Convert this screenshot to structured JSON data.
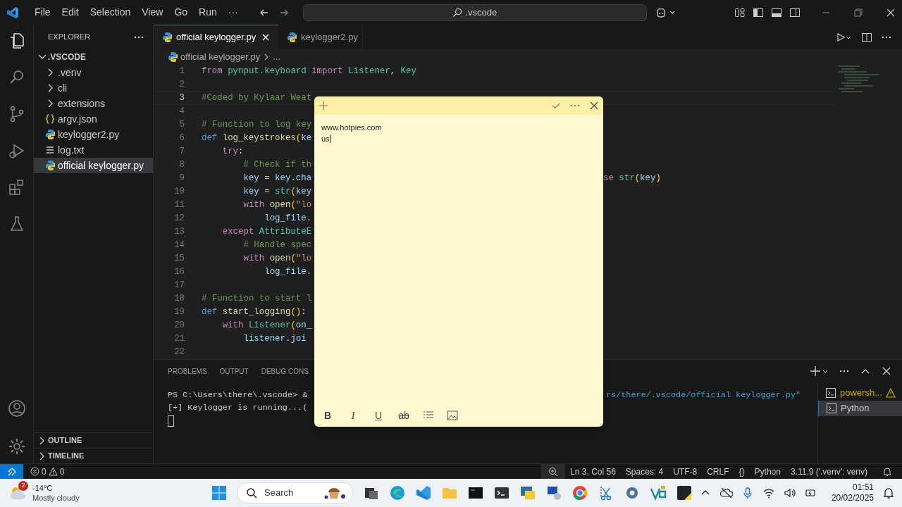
{
  "menu": [
    "File",
    "Edit",
    "Selection",
    "View",
    "Go",
    "Run",
    "···"
  ],
  "command_center": {
    "value": ".vscode"
  },
  "sidebar": {
    "title": "EXPLORER",
    "folder": ".VSCODE",
    "items": [
      {
        "label": ".venv",
        "kind": "folder",
        "selected": false
      },
      {
        "label": "cli",
        "kind": "folder",
        "selected": false
      },
      {
        "label": "extensions",
        "kind": "folder",
        "selected": false
      },
      {
        "label": "argv.json",
        "kind": "json",
        "selected": false
      },
      {
        "label": "keylogger2.py",
        "kind": "python",
        "selected": false
      },
      {
        "label": "log.txt",
        "kind": "text",
        "selected": false
      },
      {
        "label": "official keylogger.py",
        "kind": "python",
        "selected": true
      }
    ],
    "sections": [
      "OUTLINE",
      "TIMELINE"
    ]
  },
  "tabs": [
    {
      "label": "official keylogger.py",
      "selected": true
    },
    {
      "label": "keylogger2.py",
      "selected": false
    }
  ],
  "breadcrumb": [
    "official keylogger.py",
    "..."
  ],
  "code": [
    {
      "n": "1",
      "active": false,
      "tokens": [
        {
          "kind": "keyword",
          "text": "from "
        },
        {
          "kind": "module",
          "text": "pynput.keyboard "
        },
        {
          "kind": "keyword",
          "text": "import "
        },
        {
          "kind": "module",
          "text": "Listener"
        },
        {
          "kind": "plain",
          "text": ", "
        },
        {
          "kind": "module",
          "text": "Key"
        }
      ]
    },
    {
      "n": "2",
      "active": false
    },
    {
      "n": "3",
      "active": true,
      "tokens": [
        {
          "kind": "comment",
          "text": "#Coded by Kylaar Weat"
        }
      ]
    },
    {
      "n": "4",
      "active": false
    },
    {
      "n": "5",
      "active": false,
      "tokens": [
        {
          "kind": "comment",
          "text": "# Function to log key"
        }
      ]
    },
    {
      "n": "6",
      "active": false,
      "tokens": [
        {
          "kind": "define",
          "text": "def "
        },
        {
          "kind": "function",
          "text": "log_keystrokes"
        },
        {
          "kind": "paren",
          "text": "("
        },
        {
          "kind": "variable",
          "text": "ke"
        }
      ]
    },
    {
      "n": "7",
      "active": false,
      "tokens": [
        {
          "kind": "keyword",
          "text": "    try"
        },
        {
          "kind": "plain",
          "text": ":"
        }
      ]
    },
    {
      "n": "8",
      "active": false,
      "tokens": [
        {
          "kind": "comment",
          "text": "        # Check if th"
        }
      ]
    },
    {
      "n": "9",
      "active": false,
      "tokens": [
        {
          "kind": "variable",
          "text": "        key "
        },
        {
          "kind": "plain",
          "text": "= "
        },
        {
          "kind": "variable",
          "text": "key.cha"
        }
      ],
      "rest": [
        {
          "kind": "keyword",
          "text": "se "
        },
        {
          "kind": "module",
          "text": "str"
        },
        {
          "kind": "paren",
          "text": "("
        },
        {
          "kind": "variable",
          "text": "key"
        },
        {
          "kind": "paren",
          "text": ")"
        }
      ]
    },
    {
      "n": "10",
      "active": false,
      "tokens": [
        {
          "kind": "variable",
          "text": "        key "
        },
        {
          "kind": "plain",
          "text": "= "
        },
        {
          "kind": "module",
          "text": "str"
        },
        {
          "kind": "paren",
          "text": "("
        },
        {
          "kind": "variable",
          "text": "key"
        }
      ]
    },
    {
      "n": "11",
      "active": false,
      "tokens": [
        {
          "kind": "keyword",
          "text": "        with "
        },
        {
          "kind": "function",
          "text": "open"
        },
        {
          "kind": "paren",
          "text": "("
        },
        {
          "kind": "string",
          "text": "\"lo"
        }
      ]
    },
    {
      "n": "12",
      "active": false,
      "tokens": [
        {
          "kind": "variable",
          "text": "            log_file."
        }
      ]
    },
    {
      "n": "13",
      "active": false,
      "tokens": [
        {
          "kind": "keyword",
          "text": "    except "
        },
        {
          "kind": "module",
          "text": "AttributeE"
        }
      ]
    },
    {
      "n": "14",
      "active": false,
      "tokens": [
        {
          "kind": "comment",
          "text": "        # Handle spec"
        }
      ]
    },
    {
      "n": "15",
      "active": false,
      "tokens": [
        {
          "kind": "keyword",
          "text": "        with "
        },
        {
          "kind": "function",
          "text": "open"
        },
        {
          "kind": "paren",
          "text": "("
        },
        {
          "kind": "string",
          "text": "\"lo"
        }
      ]
    },
    {
      "n": "16",
      "active": false,
      "tokens": [
        {
          "kind": "variable",
          "text": "            log_file."
        }
      ]
    },
    {
      "n": "17",
      "active": false
    },
    {
      "n": "18",
      "active": false,
      "tokens": [
        {
          "kind": "comment",
          "text": "# Function to start l"
        }
      ]
    },
    {
      "n": "19",
      "active": false,
      "tokens": [
        {
          "kind": "define",
          "text": "def "
        },
        {
          "kind": "function",
          "text": "start_logging"
        },
        {
          "kind": "paren",
          "text": "()"
        },
        {
          "kind": "plain",
          "text": ":"
        }
      ]
    },
    {
      "n": "20",
      "active": false,
      "tokens": [
        {
          "kind": "keyword",
          "text": "    with "
        },
        {
          "kind": "module",
          "text": "Listener"
        },
        {
          "kind": "paren",
          "text": "("
        },
        {
          "kind": "variable",
          "text": "on_"
        }
      ]
    },
    {
      "n": "21",
      "active": false,
      "tokens": [
        {
          "kind": "variable",
          "text": "        listener.joi"
        }
      ]
    },
    {
      "n": "22",
      "active": false
    }
  ],
  "panel": {
    "tabs": [
      {
        "label": "PROBLEMS",
        "selected": false
      },
      {
        "label": "OUTPUT",
        "selected": false
      },
      {
        "label": "DEBUG CONS",
        "selected": false
      }
    ],
    "terminal_lines": [
      {
        "text": "PS C:\\Users\\there\\.vscode> &",
        "rest": "rs/there/.vscode/official keylogger.py\""
      },
      {
        "text": "[+] Keylogger is running...("
      }
    ],
    "terminals": [
      {
        "label": "powersh...",
        "warning": true,
        "selected": false
      },
      {
        "label": "Python",
        "warning": false,
        "selected": true
      }
    ]
  },
  "sticky_note": {
    "lines": [
      "www.hotpies.com",
      "us"
    ],
    "format_buttons": [
      {
        "label": "B",
        "kind": "bold"
      },
      {
        "label": "I",
        "kind": "italic"
      },
      {
        "label": "U",
        "kind": "underline"
      },
      {
        "label": "ab",
        "kind": "strike"
      }
    ]
  },
  "status_bar": {
    "errors": "0",
    "warnings": "0",
    "items": [
      "Ln 3, Col 56",
      "Spaces: 4",
      "UTF-8",
      "CRLF",
      "{}",
      "Python",
      "3.11.9 ('.venv': venv)"
    ]
  },
  "taskbar": {
    "weather": {
      "badge": "2",
      "temp": "-14°C",
      "desc": "Mostly cloudy"
    },
    "search": "Search",
    "time": "01:51",
    "date": "20/02/2025"
  }
}
